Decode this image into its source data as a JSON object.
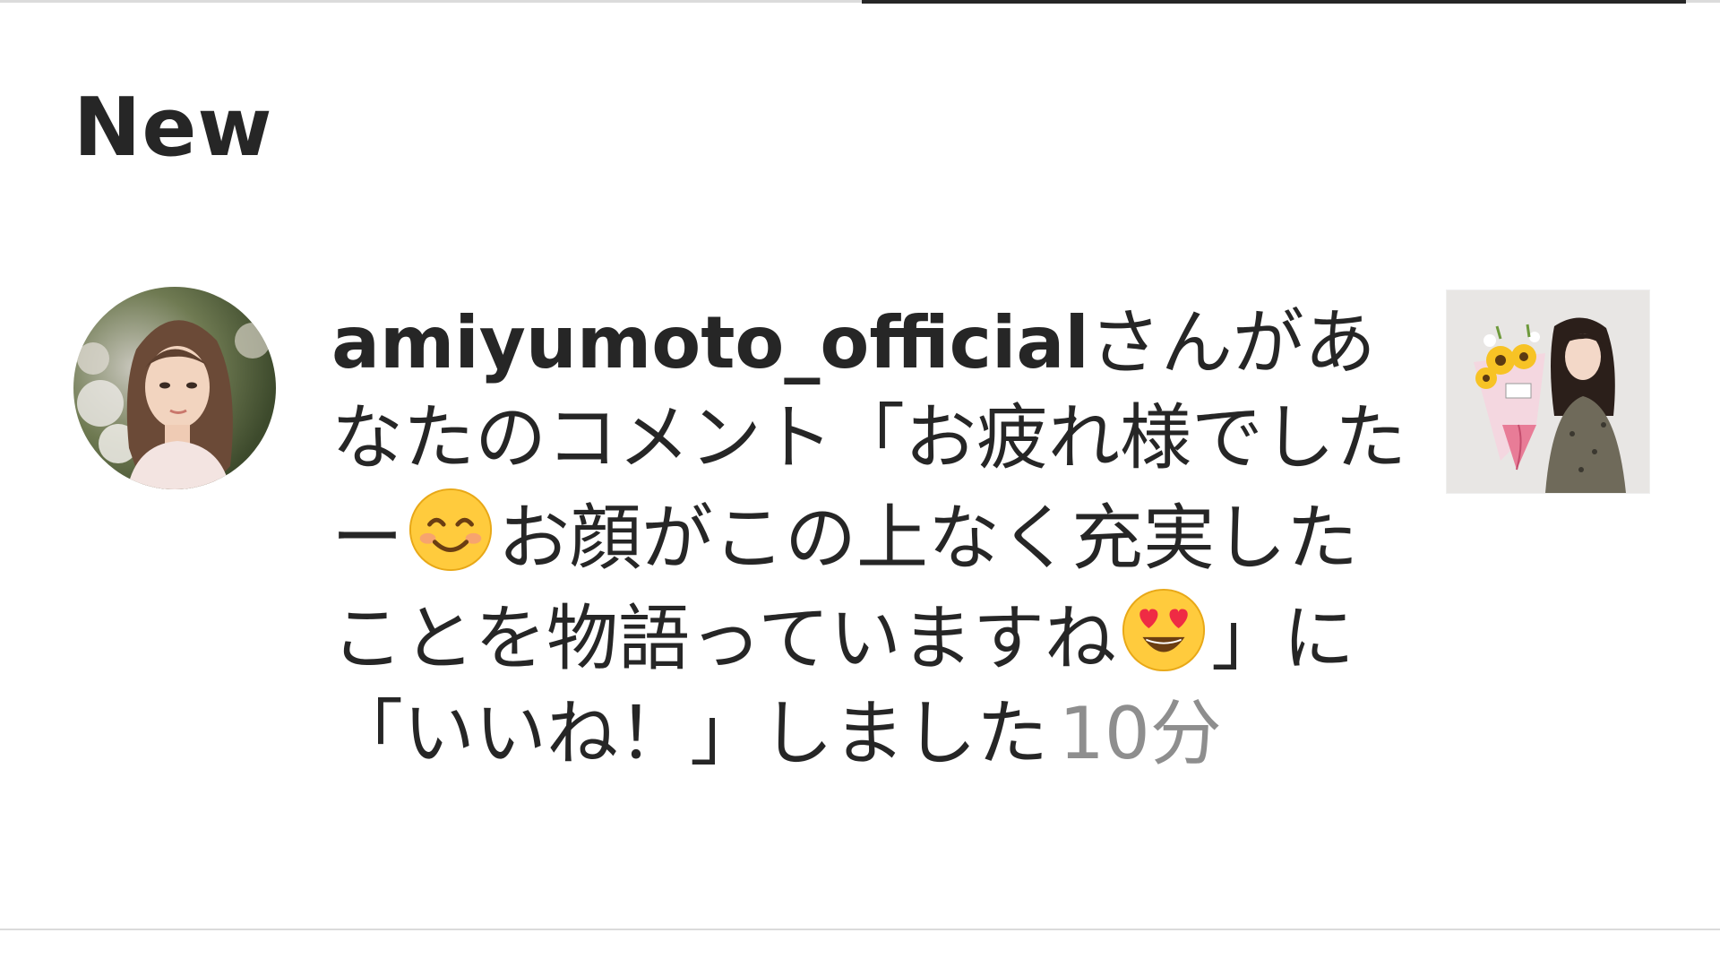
{
  "header": {
    "section_title": "New"
  },
  "notification": {
    "username": "amiyumoto_official",
    "text_part1": "さんがあなたのコメント「お疲れ様でしたー",
    "emoji1": "smiling-face-with-smiling-eyes",
    "text_part2": "お顔がこの上なく充実したことを物語っていますね",
    "emoji2": "smiling-face-with-heart-eyes",
    "text_part3": "」に「いいね！」しました",
    "timestamp": "10分",
    "avatar_icon": "profile-photo",
    "thumbnail_icon": "post-thumbnail"
  },
  "colors": {
    "text_primary": "#262626",
    "text_secondary": "#8e8e8e",
    "divider": "#dbdbdb"
  }
}
